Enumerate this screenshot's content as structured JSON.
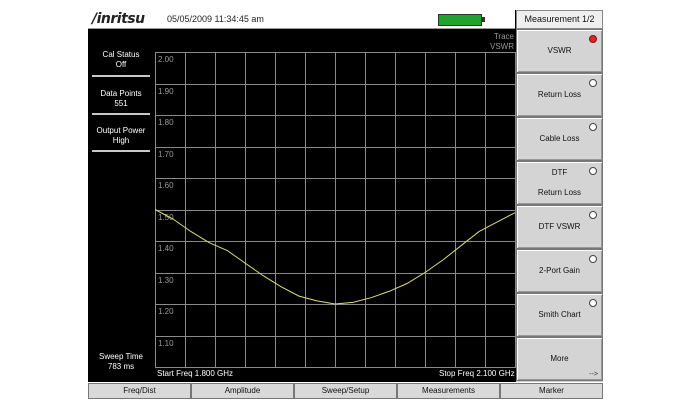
{
  "header": {
    "logo_text": "/inritsu",
    "datetime": "05/05/2009 11:34:45 am",
    "battery_color": "#1fa32d"
  },
  "status_panel": {
    "cal_status_label": "Cal Status",
    "cal_status_value": "Off",
    "data_points_label": "Data Points",
    "data_points_value": "551",
    "output_power_label": "Output Power",
    "output_power_value": "High",
    "sweep_time_label": "Sweep Time",
    "sweep_time_value": "783 ms"
  },
  "trace": {
    "trace_label": "Trace",
    "trace_type": "VSWR",
    "trace_color": "#dede6e"
  },
  "plot": {
    "y_ticks": [
      "2.00",
      "1.90",
      "1.80",
      "1.70",
      "1.60",
      "1.50",
      "1.40",
      "1.30",
      "1.20",
      "1.10"
    ],
    "start_freq": "Start Freq 1.800 GHz",
    "stop_freq": "Stop Freq 2.100 GHz",
    "vswr_curve": {
      "x_ghz": [
        1.8,
        1.815,
        1.83,
        1.845,
        1.86,
        1.875,
        1.89,
        1.905,
        1.92,
        1.935,
        1.95,
        1.965,
        1.98,
        1.995,
        2.01,
        2.025,
        2.04,
        2.055,
        2.07,
        2.085,
        2.1
      ],
      "vswr": [
        1.5,
        1.47,
        1.43,
        1.395,
        1.37,
        1.33,
        1.29,
        1.255,
        1.225,
        1.21,
        1.2,
        1.205,
        1.22,
        1.24,
        1.265,
        1.3,
        1.34,
        1.385,
        1.43,
        1.46,
        1.49
      ],
      "y_range": [
        1.0,
        2.0
      ]
    }
  },
  "softkeys": {
    "menu_title": "Measurement 1/2",
    "items": [
      {
        "label": "VSWR",
        "selected": true
      },
      {
        "label": "Return Loss",
        "selected": false
      },
      {
        "label": "Cable Loss",
        "selected": false
      },
      {
        "label": "DTF",
        "label2": "Return Loss",
        "selected": false
      },
      {
        "label": "DTF VSWR",
        "selected": false
      },
      {
        "label": "2-Port Gain",
        "selected": false
      },
      {
        "label": "Smith Chart",
        "selected": false
      },
      {
        "label": "More",
        "selected": false
      }
    ],
    "more_arrow": "-->"
  },
  "bottom_menu": {
    "items": [
      "Freq/Dist",
      "Amplitude",
      "Sweep/Setup",
      "Measurements",
      "Marker"
    ]
  }
}
